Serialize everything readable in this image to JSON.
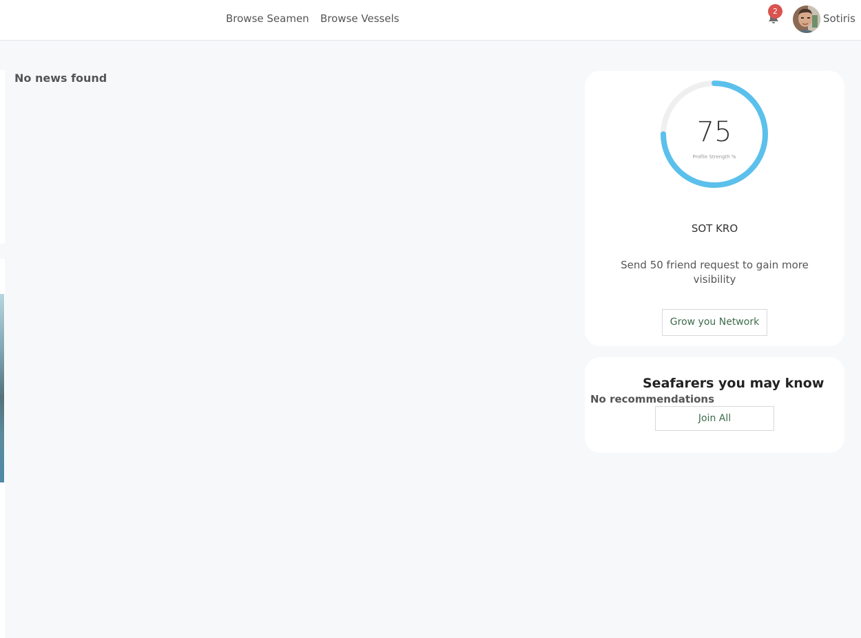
{
  "header": {
    "nav": [
      {
        "label": "Browse Seamen"
      },
      {
        "label": "Browse Vessels"
      }
    ],
    "notifications": {
      "count": "2",
      "icon": "bell-icon"
    },
    "user": {
      "name": "Sotiris",
      "avatar_icon": "user-avatar"
    }
  },
  "feed": {
    "empty_message": "No news found"
  },
  "profile_card": {
    "strength_value": "75",
    "strength_fraction": 0.75,
    "strength_caption": "Profile Strength %",
    "name": "SOT KRO",
    "hint": "Send 50 friend request to gain more visibility",
    "button_label": "Grow you Network"
  },
  "seafarers_card": {
    "title": "Seafarers you may know",
    "empty_message": "No recommendations",
    "button_label": "Join All"
  },
  "colors": {
    "accent_ring": "#5bc0eb",
    "ring_track": "#efefef",
    "badge": "#d9534f",
    "button_text": "#3d6b4a"
  }
}
